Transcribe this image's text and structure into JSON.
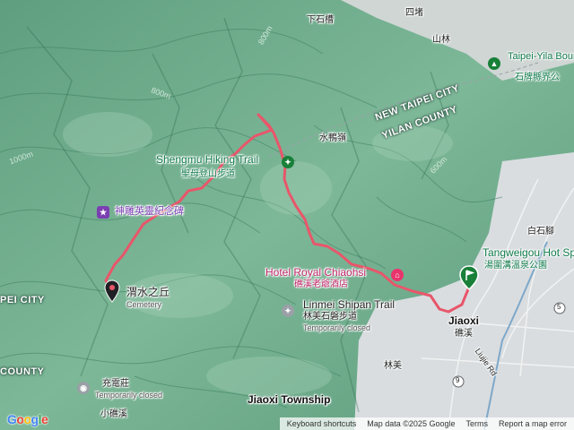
{
  "map": {
    "colors": {
      "terrain_dark": "#3e7f63",
      "terrain_mid": "#6fae8d",
      "terrain_light": "#a9d2bb",
      "urban": "#d9dde0",
      "route": "#e8566a",
      "start_pin": "#188038",
      "end_pin": "#202124"
    },
    "labels": {
      "upper_village": "下石槽",
      "top_right_village": "四堵",
      "shanlin": "山林",
      "boundary_park": "Taipei-Yila Boundary Par",
      "boundary_park_zh": "石牌縣界公",
      "new_taipei": "NEW TAIPEI CITY",
      "yilan_county": "YILAN COUNTY",
      "shuiya": "水鴨嶺",
      "shengmu_trail": "Shengmu Hiking Trail",
      "shengmu_trail_zh": "聖母登山步道",
      "kamikaze_memorial": "神雕英靈紀念碑",
      "cemetery_zh": "渭水之丘",
      "cemetery": "Cemetery",
      "baishi": "白石腳",
      "hot_spring_park": "Tangweigou Hot Spring Park",
      "hot_spring_park_zh": "湯圍溝溫泉公園",
      "hotel": "Hotel Royal Chiaohsi",
      "hotel_zh": "礁溪老爺酒店",
      "linmei_trail": "Linmei Shipan Trail",
      "linmei_trail_zh": "林美石磐步道",
      "linmei_closed": "Temporarily closed",
      "jiaoxi": "Jiaoxi",
      "jiaoxi_zh": "礁溪",
      "linmei": "林美",
      "lujie_rd": "Liujie Rd",
      "pei_city": "PEI CITY",
      "county_left": "COUNTY",
      "chongdian": "充電莊",
      "chongdian_closed": "Temporarily closed",
      "xiaojiaoxi": "小礁溪",
      "jiaoxi_township": "Jiaoxi Township",
      "route_9": "9",
      "route_5": "5"
    },
    "contours": [
      "800m",
      "800m",
      "1000m",
      "600m"
    ],
    "footer": {
      "google": [
        "G",
        "o",
        "o",
        "g",
        "l",
        "e"
      ],
      "google_colors": [
        "#4285F4",
        "#EA4335",
        "#FBBC05",
        "#4285F4",
        "#34A853",
        "#EA4335"
      ],
      "shortcuts": "Keyboard shortcuts",
      "data": "Map data ©2025 Google",
      "terms": "Terms",
      "report": "Report a map error"
    }
  }
}
